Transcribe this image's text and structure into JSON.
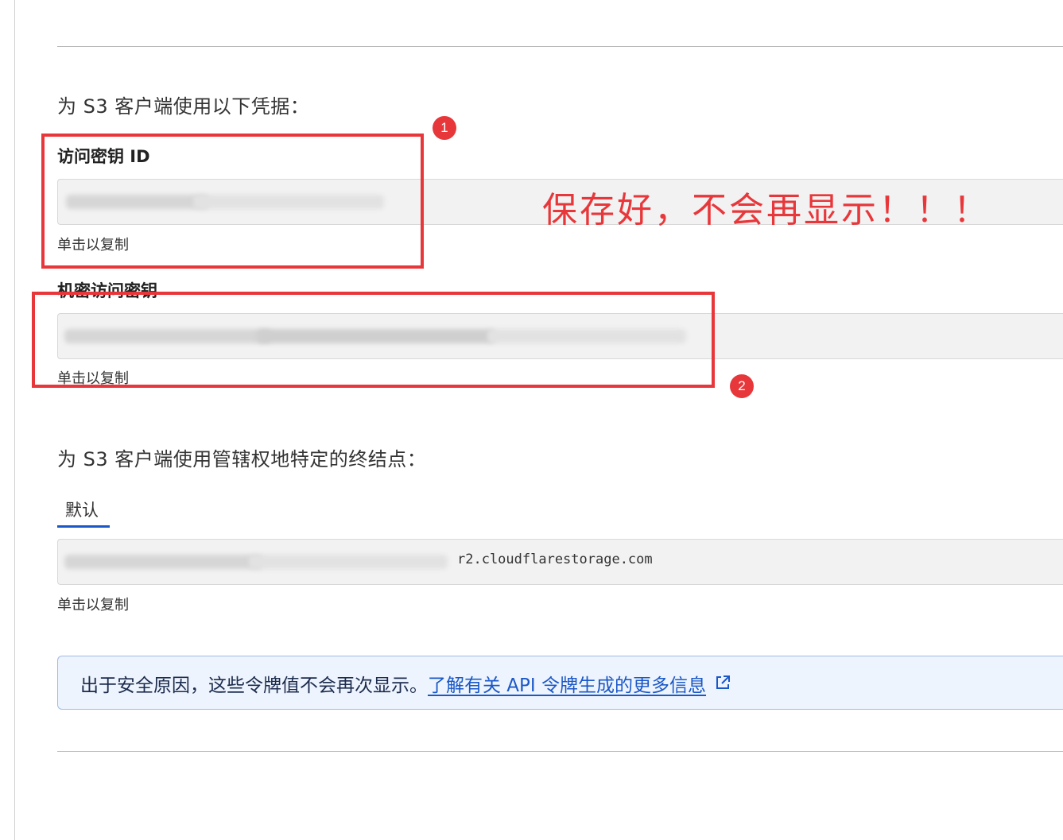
{
  "credentials_heading": "为 S3 客户端使用以下凭据：",
  "access_key": {
    "label": "访问密钥 ID",
    "copy_hint": "单击以复制"
  },
  "secret_key": {
    "label": "机密访问密钥",
    "copy_hint": "单击以复制"
  },
  "endpoint_heading": "为 S3 客户端使用管辖权地特定的终结点：",
  "endpoint_tab": "默认",
  "endpoint": {
    "value_suffix": "r2.cloudflarestorage.com",
    "copy_hint": "单击以复制"
  },
  "notice": {
    "text": "出于安全原因，这些令牌值不会再次显示。",
    "link": "了解有关 API 令牌生成的更多信息",
    "link_icon": "external-link-icon"
  },
  "annotations": {
    "badge_1": "1",
    "badge_2": "2",
    "warning": "保存好，不会再显示！！！",
    "color": "#e8373a"
  },
  "colors": {
    "accent": "#1a58c8",
    "notice_bg": "#eef4fd",
    "field_bg": "#f2f2f2"
  }
}
